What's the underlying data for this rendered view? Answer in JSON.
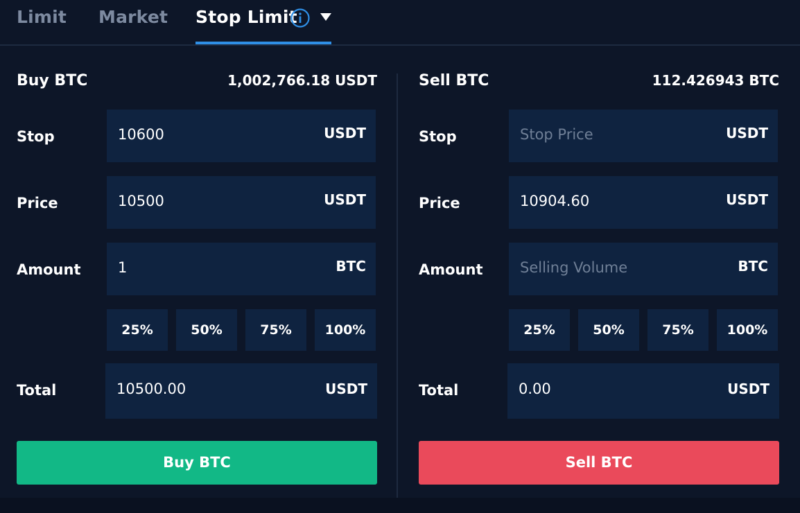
{
  "tabs": [
    {
      "label": "Limit"
    },
    {
      "label": "Market"
    },
    {
      "label": "Stop Limit"
    }
  ],
  "buy": {
    "title": "Buy BTC",
    "balance": "1,002,766.18 USDT",
    "stop": {
      "label": "Stop",
      "value": "10600",
      "placeholder": "",
      "unit": "USDT"
    },
    "price": {
      "label": "Price",
      "value": "10500",
      "unit": "USDT"
    },
    "amount": {
      "label": "Amount",
      "value": "1",
      "unit": "BTC"
    },
    "percents": [
      "25%",
      "50%",
      "75%",
      "100%"
    ],
    "total": {
      "label": "Total",
      "value": "10500.00",
      "unit": "USDT"
    },
    "button": "Buy BTC"
  },
  "sell": {
    "title": "Sell BTC",
    "balance": "112.426943 BTC",
    "stop": {
      "label": "Stop",
      "value": "",
      "placeholder": "Stop Price",
      "unit": "USDT"
    },
    "price": {
      "label": "Price",
      "value": "10904.60",
      "unit": "USDT"
    },
    "amount": {
      "label": "Amount",
      "value": "",
      "placeholder": "Selling Volume",
      "unit": "BTC"
    },
    "percents": [
      "25%",
      "50%",
      "75%",
      "100%"
    ],
    "total": {
      "label": "Total",
      "value": "0.00",
      "unit": "USDT"
    },
    "button": "Sell BTC"
  },
  "colors": {
    "background": "#0d1628",
    "field": "#0f2340",
    "accent": "#2f8fe6",
    "buy": "#12b886",
    "sell": "#ea4a5b",
    "muted": "#7d8aa0"
  }
}
